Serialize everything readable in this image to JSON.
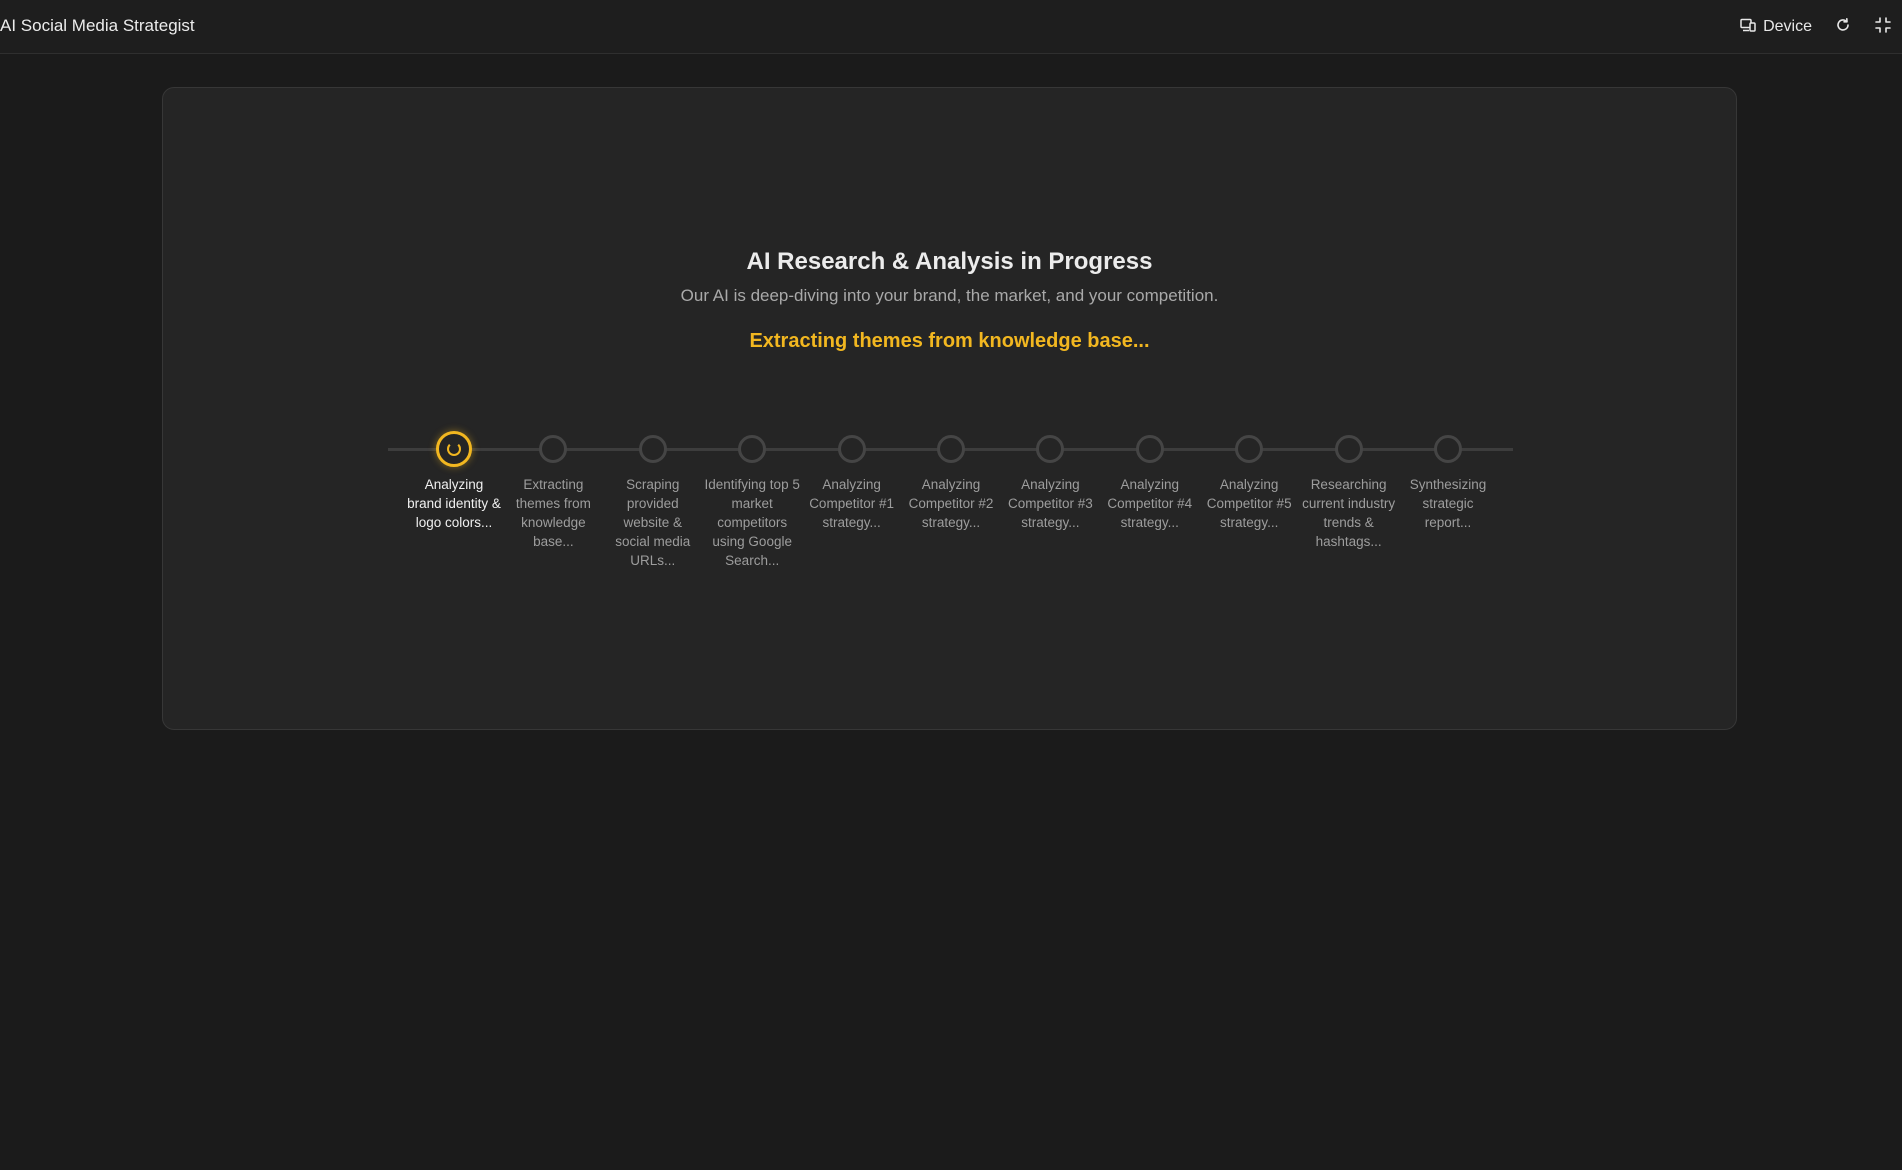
{
  "header": {
    "title": "AI Social Media Strategist",
    "device_label": "Device",
    "icons": {
      "device": "device-icon",
      "refresh": "refresh-icon",
      "fullscreen": "fullscreen-icon"
    }
  },
  "main": {
    "heading": "AI Research & Analysis in Progress",
    "subheading": "Our AI is deep-diving into your brand, the market, and your competition.",
    "current_status": "Extracting themes from knowledge base...",
    "accent_color": "#f2b720",
    "steps": [
      {
        "label": "Analyzing brand identity & logo colors...",
        "state": "active"
      },
      {
        "label": "Extracting themes from knowledge base...",
        "state": "pending"
      },
      {
        "label": "Scraping provided website & social media URLs...",
        "state": "pending"
      },
      {
        "label": "Identifying top 5 market competitors using Google Search...",
        "state": "pending"
      },
      {
        "label": "Analyzing Competitor #1 strategy...",
        "state": "pending"
      },
      {
        "label": "Analyzing Competitor #2 strategy...",
        "state": "pending"
      },
      {
        "label": "Analyzing Competitor #3 strategy...",
        "state": "pending"
      },
      {
        "label": "Analyzing Competitor #4 strategy...",
        "state": "pending"
      },
      {
        "label": "Analyzing Competitor #5 strategy...",
        "state": "pending"
      },
      {
        "label": "Researching current industry trends & hashtags...",
        "state": "pending"
      },
      {
        "label": "Synthesizing strategic report...",
        "state": "pending"
      }
    ]
  }
}
